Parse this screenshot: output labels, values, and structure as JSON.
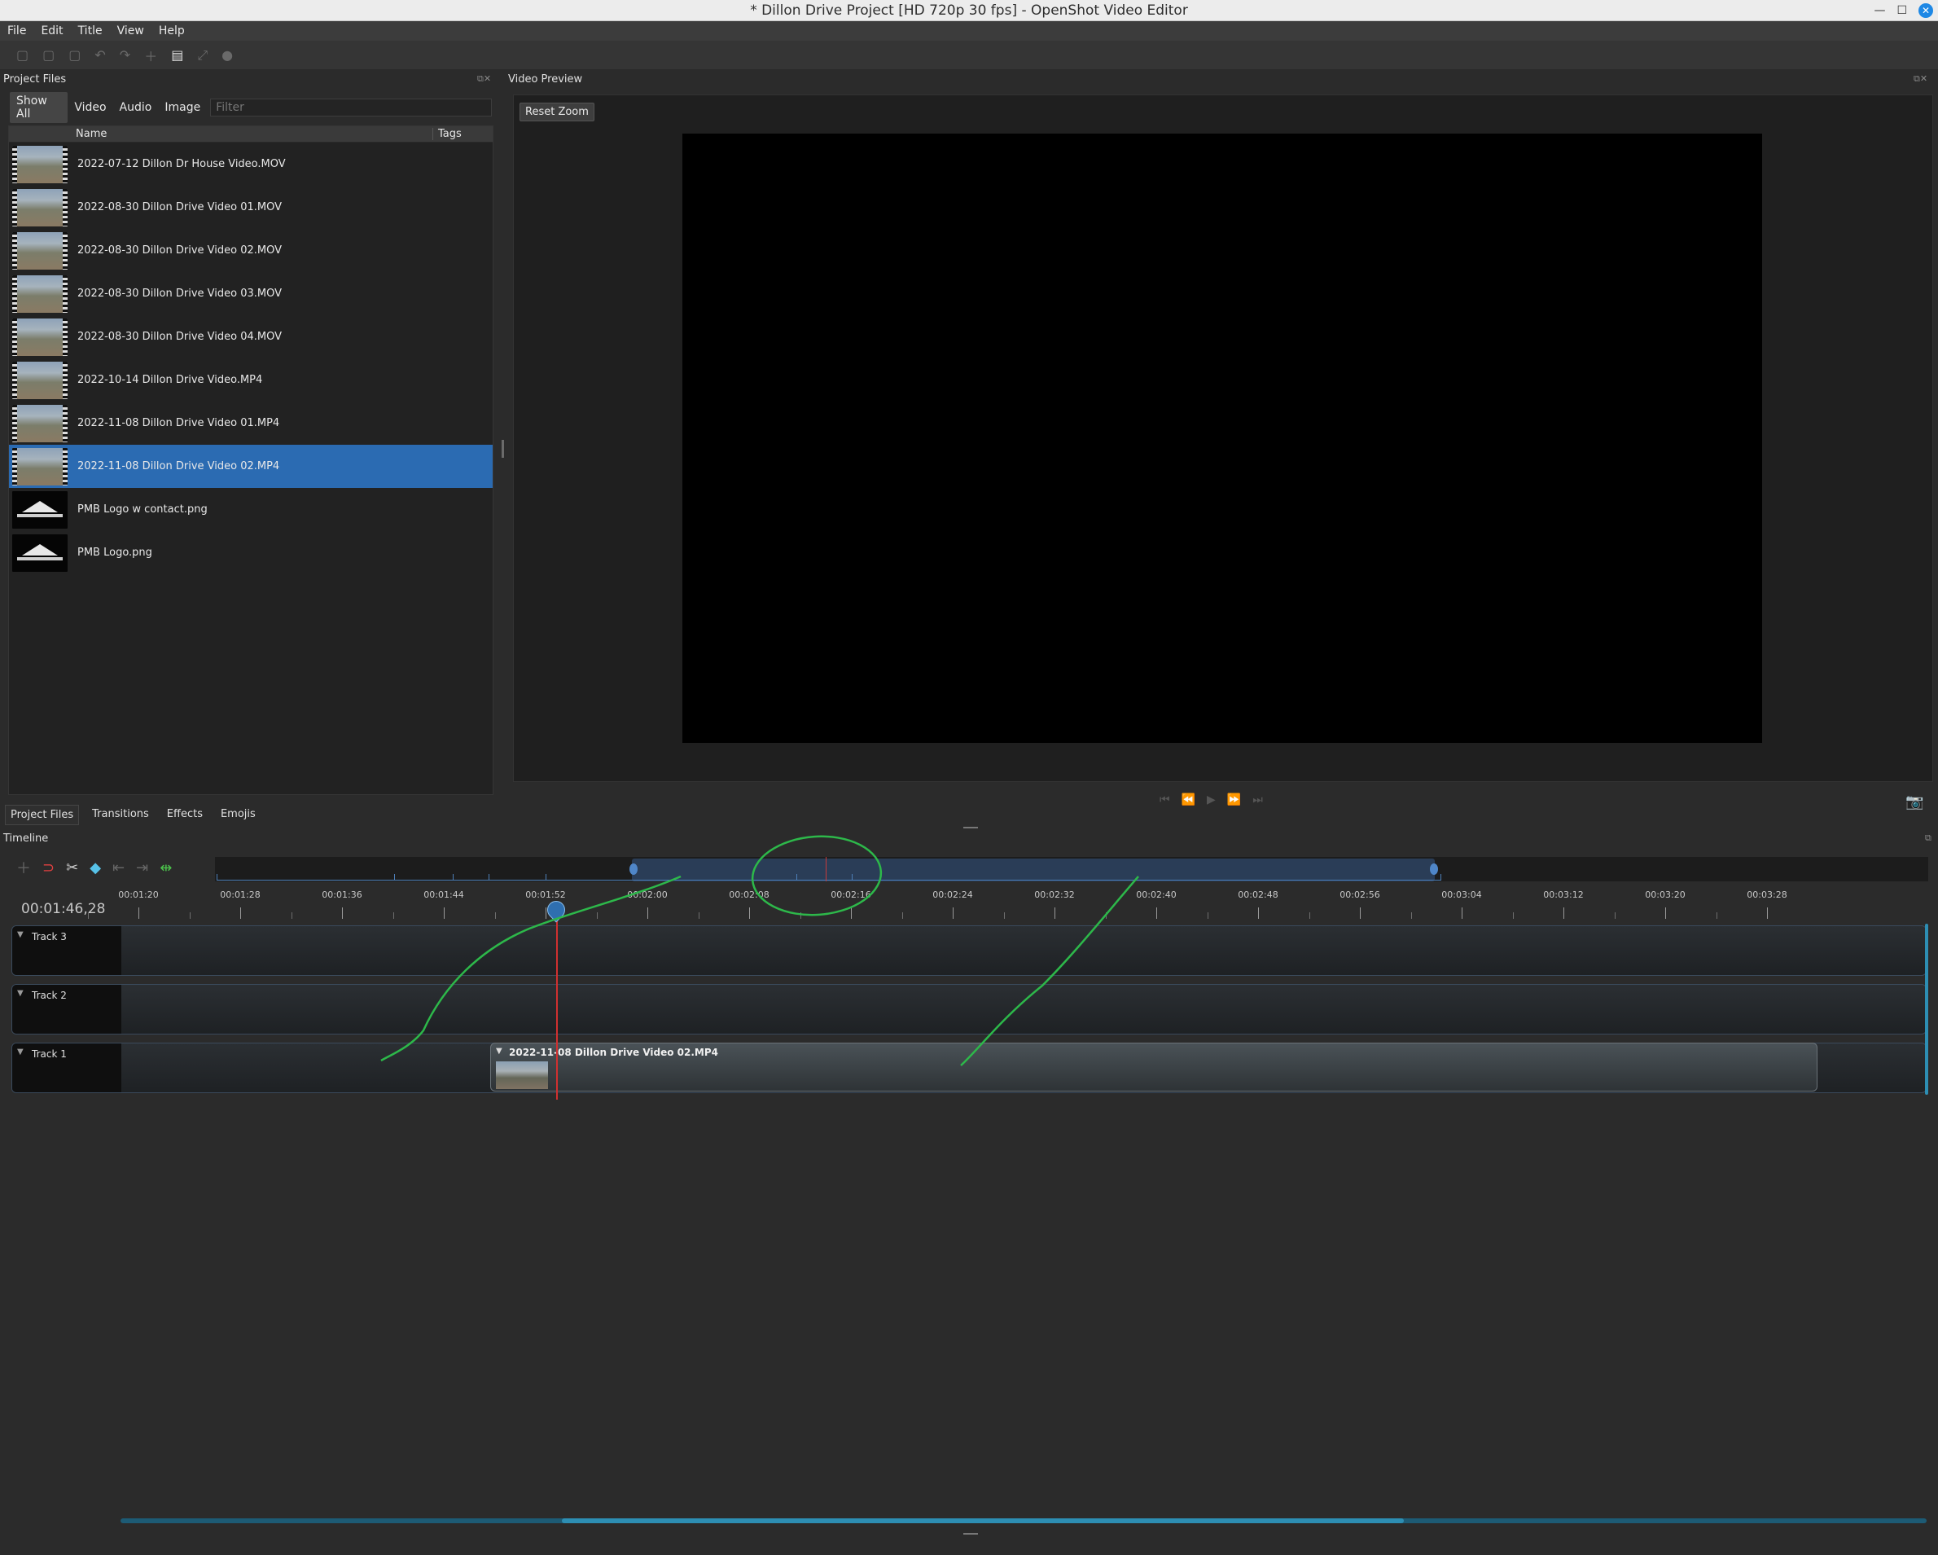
{
  "window": {
    "title": "* Dillon Drive Project [HD 720p 30 fps] - OpenShot Video Editor"
  },
  "menu": [
    "File",
    "Edit",
    "Title",
    "View",
    "Help"
  ],
  "project_files": {
    "title": "Project Files",
    "filters": [
      "Show All",
      "Video",
      "Audio",
      "Image"
    ],
    "filter_placeholder": "Filter",
    "columns": {
      "name": "Name",
      "tags": "Tags"
    },
    "items": [
      {
        "name": "2022-07-12 Dillon Dr House Video.MOV",
        "kind": "video"
      },
      {
        "name": "2022-08-30 Dillon Drive Video 01.MOV",
        "kind": "video"
      },
      {
        "name": "2022-08-30 Dillon Drive Video 02.MOV",
        "kind": "video"
      },
      {
        "name": "2022-08-30 Dillon Drive Video 03.MOV",
        "kind": "video"
      },
      {
        "name": "2022-08-30 Dillon Drive Video 04.MOV",
        "kind": "video"
      },
      {
        "name": "2022-10-14 Dillon Drive Video.MP4",
        "kind": "video"
      },
      {
        "name": "2022-11-08 Dillon Drive Video 01.MP4",
        "kind": "video"
      },
      {
        "name": "2022-11-08 Dillon Drive Video 02.MP4",
        "kind": "video",
        "selected": true
      },
      {
        "name": "PMB Logo w contact.png",
        "kind": "logo"
      },
      {
        "name": "PMB Logo.png",
        "kind": "logo"
      }
    ]
  },
  "video_preview": {
    "title": "Video Preview",
    "reset_zoom": "Reset Zoom"
  },
  "dock_tabs": [
    "Project Files",
    "Transitions",
    "Effects",
    "Emojis"
  ],
  "timeline": {
    "title": "Timeline",
    "current_time": "00:01:46,28",
    "ruler_labels": [
      "00:01:20",
      "00:01:28",
      "00:01:36",
      "00:01:44",
      "00:01:52",
      "00:02:00",
      "00:02:08",
      "00:02:16",
      "00:02:24",
      "00:02:32",
      "00:02:40",
      "00:02:48",
      "00:02:56",
      "00:03:04",
      "00:03:12",
      "00:03:20",
      "00:03:28"
    ],
    "tracks": [
      "Track 3",
      "Track 2",
      "Track 1"
    ],
    "clip": {
      "name": "2022-11-08 Dillon Drive Video 02.MP4",
      "track": "Track 1"
    }
  },
  "colors": {
    "selection": "#2b6bb2",
    "playhead": "#d03030",
    "annotation": "#2db84a"
  }
}
